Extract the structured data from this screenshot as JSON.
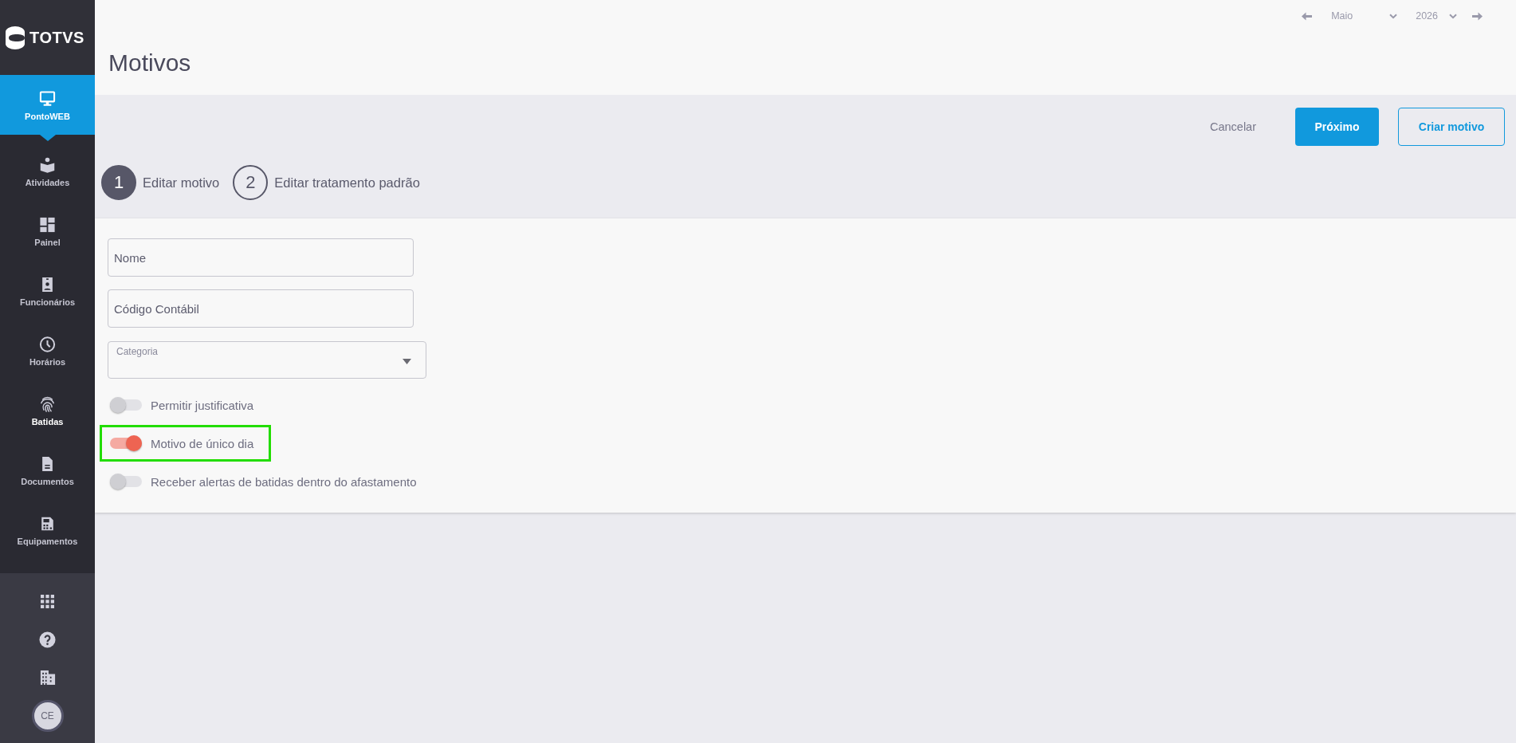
{
  "sidebar": {
    "logo": "TOTVS",
    "items": [
      {
        "label": "PontoWEB",
        "selected": true,
        "hovered": false
      },
      {
        "label": "Atividades",
        "selected": false,
        "hovered": false
      },
      {
        "label": "Painel",
        "selected": false,
        "hovered": false
      },
      {
        "label": "Funcionários",
        "selected": false,
        "hovered": false
      },
      {
        "label": "Horários",
        "selected": false,
        "hovered": false
      },
      {
        "label": "Batidas",
        "selected": false,
        "hovered": true
      },
      {
        "label": "Documentos",
        "selected": false,
        "hovered": false
      },
      {
        "label": "Equipamentos",
        "selected": false,
        "hovered": false
      }
    ],
    "user": {
      "initials": "CE"
    }
  },
  "header": {
    "title": "Motivos",
    "month": "Maio",
    "year": "2026"
  },
  "actions": [
    {
      "label": "Cancelar",
      "kind": "text"
    },
    {
      "label": "Próximo",
      "kind": "primary"
    },
    {
      "label": "Criar motivo",
      "kind": "outline"
    }
  ],
  "stepper": [
    {
      "number": "1",
      "label": "Editar motivo",
      "selected": true
    },
    {
      "number": "2",
      "label": "Editar tratamento padrão",
      "selected": false
    }
  ],
  "form": {
    "fields": [
      {
        "kind": "text",
        "placeholder": "Nome"
      },
      {
        "kind": "text",
        "placeholder": "Código Contábil"
      },
      {
        "kind": "select",
        "label": "Categoria"
      }
    ],
    "toggles": [
      {
        "label": "Permitir justificativa",
        "on": false,
        "highlighted": false
      },
      {
        "label": "Motivo de único dia",
        "on": true,
        "highlighted": true
      },
      {
        "label": "Receber alertas de batidas dentro do afastamento",
        "on": false,
        "highlighted": false
      }
    ]
  }
}
